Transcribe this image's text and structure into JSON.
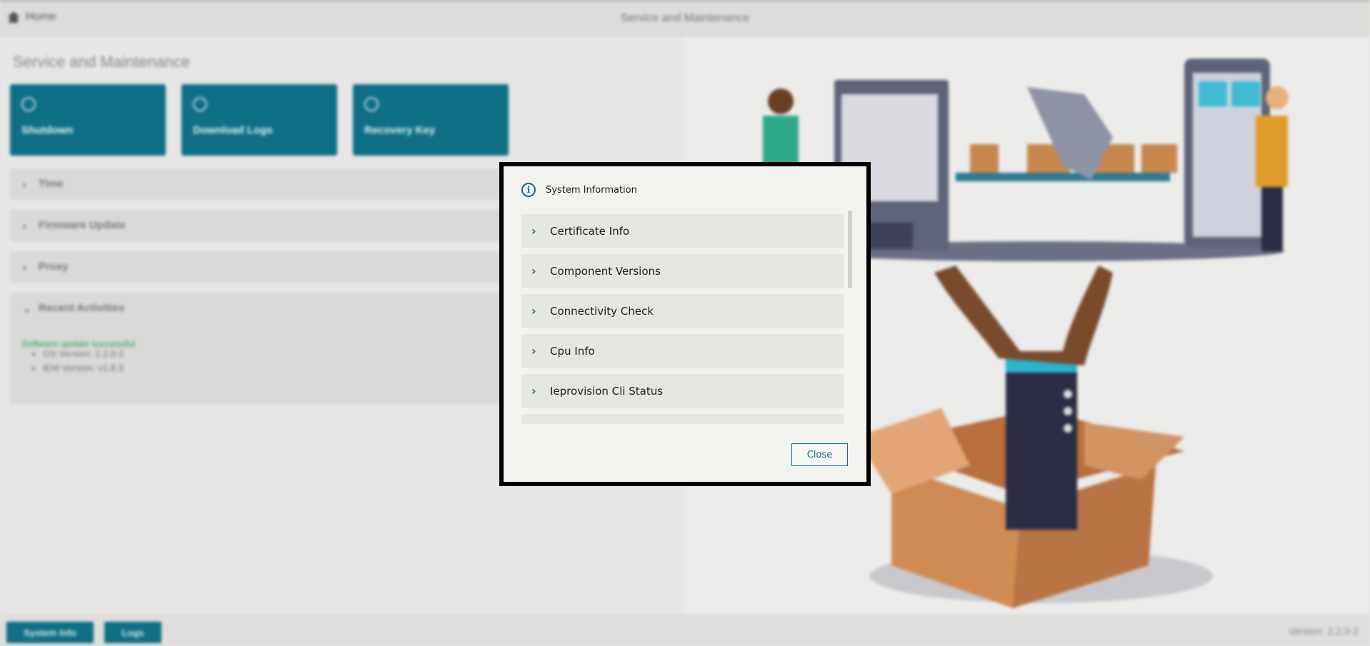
{
  "topbar": {
    "home_label": "Home",
    "center_title": "Service and Maintenance"
  },
  "page": {
    "title": "Service and Maintenance"
  },
  "tiles": [
    {
      "label": "Shutdown"
    },
    {
      "label": "Download Logs"
    },
    {
      "label": "Recovery Key"
    }
  ],
  "accordions": [
    {
      "label": "Time"
    },
    {
      "label": "Firmware Update"
    },
    {
      "label": "Proxy"
    },
    {
      "label": "Recent Activities"
    }
  ],
  "recent": {
    "status": "Software update successful",
    "items": [
      "OS Version: 2.2.0-2",
      "IEM Version: v1.8.3"
    ]
  },
  "bottombar": {
    "system_info_label": "System Info",
    "logs_label": "Logs",
    "version": "Version: 2.2.0-2"
  },
  "dialog": {
    "title": "System Information",
    "items": [
      {
        "label": "Certificate Info"
      },
      {
        "label": "Component Versions"
      },
      {
        "label": "Connectivity Check"
      },
      {
        "label": "Cpu Info"
      },
      {
        "label": "Ieprovision Cli Status"
      }
    ],
    "close_label": "Close"
  },
  "colors": {
    "accent": "#0e6f86",
    "success": "#2aa35c",
    "overlay_border": "#000000"
  }
}
